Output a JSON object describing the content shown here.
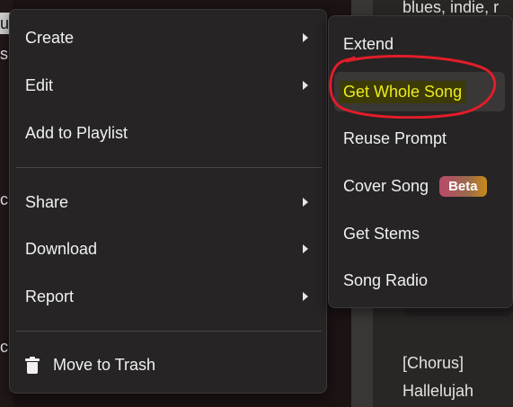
{
  "background": {
    "left_letters": [
      "ul",
      "s",
      "c",
      "c"
    ],
    "right_text": {
      "top_genres": "blues, indie, r",
      "lyrics_section": "[Chorus]",
      "lyrics_line": "Hallelujah"
    }
  },
  "menu": {
    "items": [
      {
        "label": "Create",
        "has_submenu": true
      },
      {
        "label": "Edit",
        "has_submenu": true
      },
      {
        "label": "Add to Playlist",
        "has_submenu": false
      },
      {
        "label": "Share",
        "has_submenu": true
      },
      {
        "label": "Download",
        "has_submenu": true
      },
      {
        "label": "Report",
        "has_submenu": true
      }
    ],
    "trash_label": "Move to Trash"
  },
  "submenu": {
    "items": [
      {
        "label": "Extend"
      },
      {
        "label": "Get Whole Song",
        "highlighted": true
      },
      {
        "label": "Reuse Prompt"
      },
      {
        "label": "Cover Song",
        "badge": "Beta"
      },
      {
        "label": "Get Stems"
      },
      {
        "label": "Song Radio"
      }
    ]
  },
  "colors": {
    "menu_bg": "#262424",
    "highlight_text": "#ecec1e",
    "annotation_red": "#e11d2a"
  }
}
